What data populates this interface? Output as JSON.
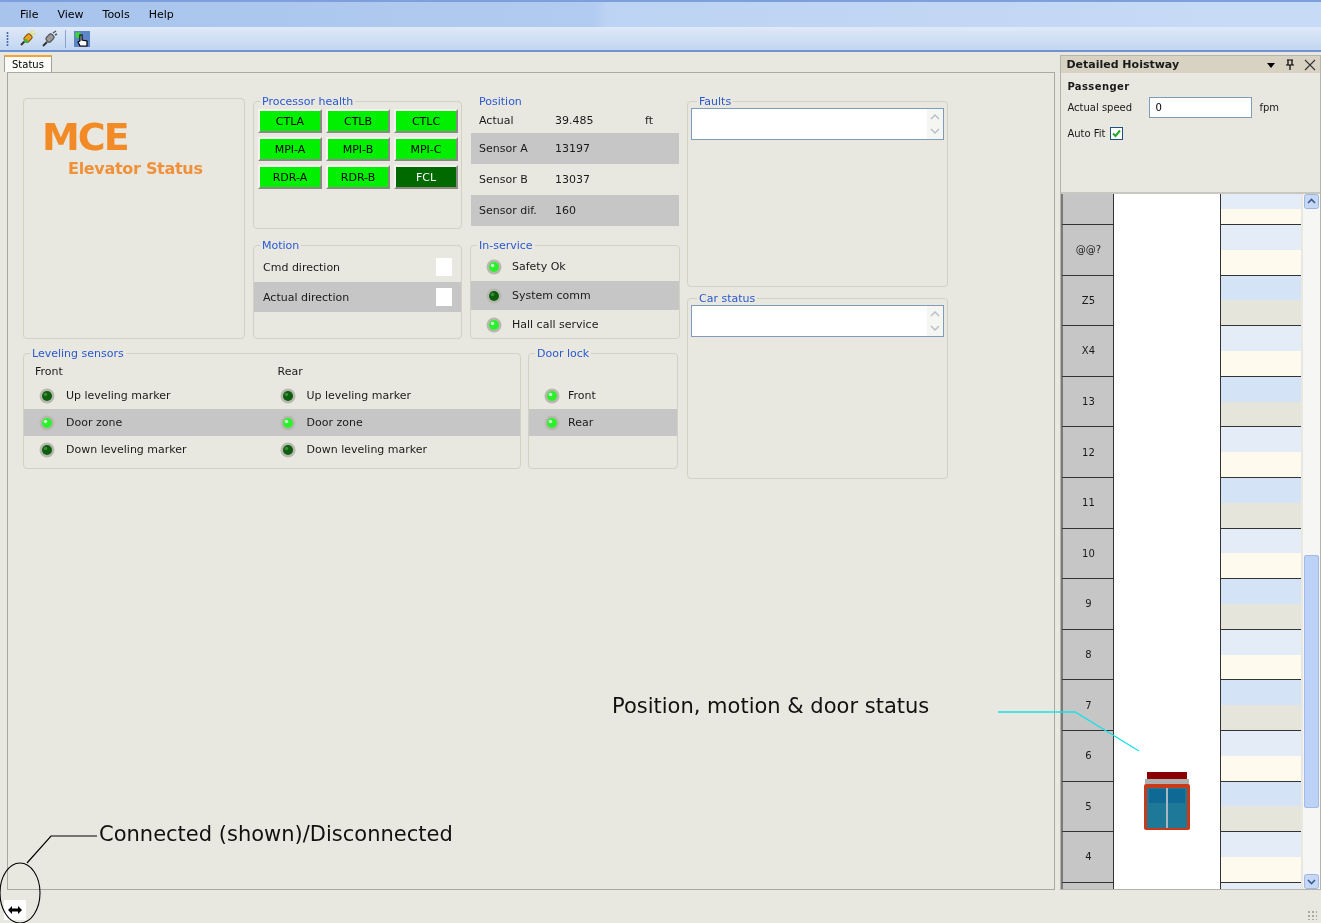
{
  "menu": [
    "File",
    "View",
    "Tools",
    "Help"
  ],
  "toolbar": [
    {
      "kind": "connect"
    },
    {
      "kind": "disconnect"
    },
    {
      "kind": "pointer"
    }
  ],
  "tabs": [
    {
      "label": "Status",
      "selected": true
    }
  ],
  "logo": {
    "brand": "MCE",
    "subtitle": "Elevator Status"
  },
  "processor_health": {
    "title": "Processor health",
    "units": [
      {
        "label": "CTLA",
        "on": true
      },
      {
        "label": "CTLB",
        "on": true
      },
      {
        "label": "CTLC",
        "on": true
      },
      {
        "label": "MPI-A",
        "on": true
      },
      {
        "label": "MPI-B",
        "on": true
      },
      {
        "label": "MPI-C",
        "on": true
      },
      {
        "label": "RDR-A",
        "on": true
      },
      {
        "label": "RDR-B",
        "on": true
      },
      {
        "label": "FCL",
        "on": false
      }
    ]
  },
  "position": {
    "title": "Position",
    "rows": [
      {
        "label": "Actual",
        "value": "39.485",
        "unit": "ft"
      },
      {
        "label": "Sensor A",
        "value": "13197"
      },
      {
        "label": "Sensor B",
        "value": "13037"
      },
      {
        "label": "Sensor dif.",
        "value": "160"
      }
    ]
  },
  "faults": {
    "title": "Faults"
  },
  "motion": {
    "title": "Motion",
    "rows": [
      {
        "label": "Cmd direction"
      },
      {
        "label": "Actual direction"
      }
    ]
  },
  "in_service": {
    "title": "In-service",
    "items": [
      {
        "label": "Safety Ok",
        "on": true
      },
      {
        "label": "System comm",
        "on": false
      },
      {
        "label": "Hall call service",
        "on": true
      }
    ]
  },
  "car_status": {
    "title": "Car status"
  },
  "leveling_sensors": {
    "title": "Leveling sensors",
    "sides": [
      {
        "heading": "Front",
        "items": [
          {
            "label": "Up leveling marker",
            "on": false
          },
          {
            "label": "Door zone",
            "on": true
          },
          {
            "label": "Down leveling marker",
            "on": false
          }
        ]
      },
      {
        "heading": "Rear",
        "items": [
          {
            "label": "Up leveling marker",
            "on": false
          },
          {
            "label": "Door zone",
            "on": true
          },
          {
            "label": "Down leveling marker",
            "on": false
          }
        ]
      }
    ]
  },
  "door_lock": {
    "title": "Door lock",
    "items": [
      {
        "label": "Front",
        "on": true
      },
      {
        "label": "Rear",
        "on": true
      }
    ]
  },
  "hoistway_panel": {
    "title": "Detailed Hoistway",
    "car_type": "Passenger",
    "speed_label": "Actual speed",
    "speed_value": "0",
    "speed_unit": "fpm",
    "auto_fit": {
      "label": "Auto Fit",
      "checked": true
    },
    "floors": [
      {
        "label": "@@?",
        "car": false
      },
      {
        "label": "Z5",
        "car": false
      },
      {
        "label": "X4",
        "car": false
      },
      {
        "label": "13",
        "car": false
      },
      {
        "label": "12",
        "car": false
      },
      {
        "label": "11",
        "car": false
      },
      {
        "label": "10",
        "car": false
      },
      {
        "label": "9",
        "car": false
      },
      {
        "label": "8",
        "car": false
      },
      {
        "label": "7",
        "car": false
      },
      {
        "label": "6",
        "car": false
      },
      {
        "label": "5",
        "car": true
      },
      {
        "label": "4",
        "car": false
      }
    ]
  },
  "status_bar": {
    "connected": true
  },
  "annotations": [
    {
      "kind": "hoistway",
      "text": "Position, motion & door status"
    },
    {
      "kind": "connection",
      "text": "Connected (shown)/Disconnected"
    }
  ]
}
